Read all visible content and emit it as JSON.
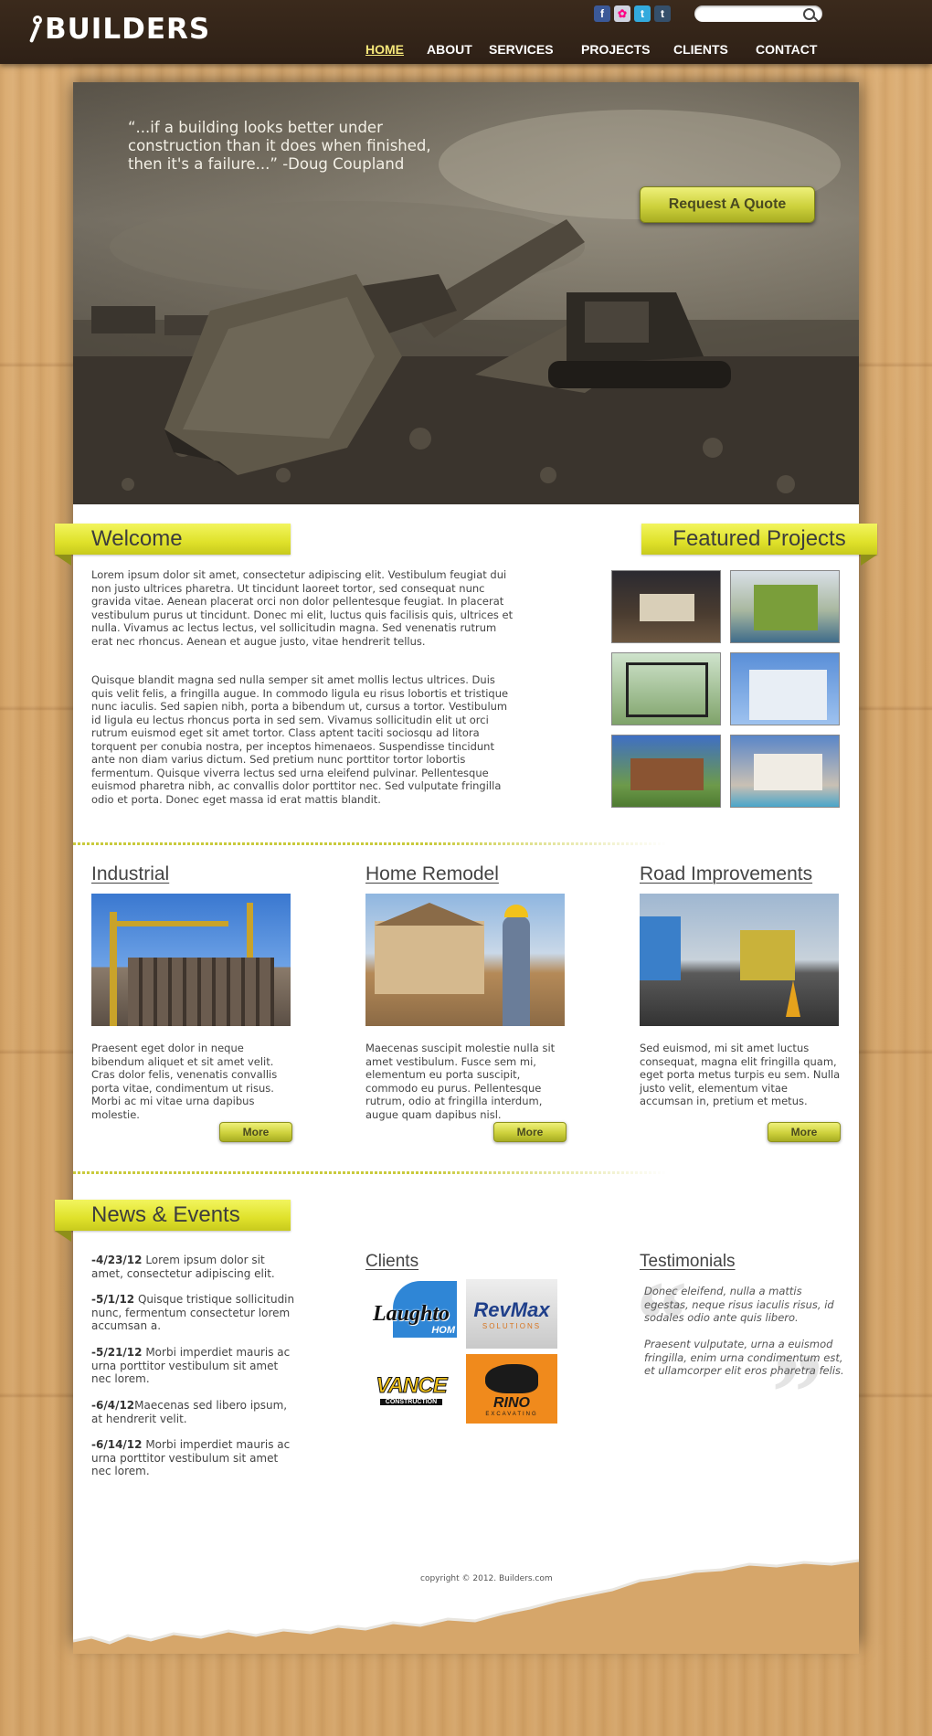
{
  "header": {
    "logo": "BUILDERS",
    "nav": [
      "HOME",
      "ABOUT",
      "SERVICES",
      "PROJECTS",
      "CLIENTS",
      "CONTACT"
    ],
    "social": [
      "f",
      "✿",
      "t",
      "t"
    ],
    "social_icons": [
      "facebook-icon",
      "flickr-icon",
      "twitter-icon",
      "tumblr-icon"
    ],
    "search": {
      "placeholder": ""
    }
  },
  "hero": {
    "quote": "“...if a building looks better under construction than it does when finished, then it's a failure...” -Doug Coupland",
    "button": "Request A Quote"
  },
  "welcome": {
    "title": "Welcome",
    "p1": "Lorem ipsum dolor sit amet, consectetur adipiscing elit. Vestibulum feugiat dui non justo ultrices pharetra. Ut tincidunt laoreet tortor, sed consequat nunc gravida vitae. Aenean placerat orci non dolor pellentesque feugiat. In placerat vestibulum purus ut tincidunt. Donec mi elit, luctus quis facilisis quis, ultrices et nulla. Vivamus ac lectus lectus, vel sollicitudin magna. Sed venenatis rutrum erat nec rhoncus. Aenean et augue justo, vitae hendrerit tellus.",
    "p2": "Quisque blandit magna sed nulla semper sit amet mollis lectus ultrices. Duis quis velit felis, a fringilla augue. In commodo ligula eu risus lobortis et tristique nunc iaculis. Sed sapien nibh, porta a bibendum ut, cursus a tortor. Vestibulum id ligula eu lectus rhoncus porta in sed sem. Vivamus sollicitudin elit ut orci rutrum euismod eget sit amet tortor. Class aptent taciti sociosqu ad litora torquent per conubia nostra, per inceptos himenaeos. Suspendisse tincidunt ante non diam varius dictum. Sed pretium nunc porttitor tortor lobortis fermentum. Quisque viverra lectus sed urna eleifend pulvinar. Pellentesque euismod pharetra nibh, ac convallis dolor porttitor nec. Sed vulputate fringilla odio et porta. Donec eget massa id erat mattis blandit."
  },
  "featured": {
    "title": "Featured Projects"
  },
  "services": [
    {
      "title": "Industrial",
      "text": "Praesent eget dolor in neque bibendum aliquet et sit amet velit. Cras dolor felis, venenatis convallis porta vitae, condimentum ut risus. Morbi ac mi vitae urna dapibus molestie.",
      "more": "More"
    },
    {
      "title": "Home Remodel",
      "text": "Maecenas suscipit molestie nulla sit amet vestibulum. Fusce sem mi, elementum eu porta suscipit, commodo eu purus. Pellentesque rutrum, odio at fringilla interdum, augue quam dapibus nisl.",
      "more": "More"
    },
    {
      "title": "Road Improvements",
      "text": "Sed euismod, mi sit amet luctus consequat, magna elit fringilla quam, eget porta metus turpis eu sem. Nulla justo velit, elementum vitae accumsan in, pretium et metus.",
      "more": "More"
    }
  ],
  "news": {
    "title": "News & Events",
    "items": [
      {
        "date": "-4/23/12",
        "text": "Lorem ipsum dolor sit amet, consectetur adipiscing elit."
      },
      {
        "date": "-5/1/12",
        "text": "Quisque tristique sollicitudin nunc, fermentum consectetur lorem accumsan a."
      },
      {
        "date": "-5/21/12",
        "text": "Morbi imperdiet mauris ac urna porttitor vestibulum sit amet nec lorem."
      },
      {
        "date": "-6/4/12",
        "text": "Maecenas sed libero ipsum, at hendrerit velit."
      },
      {
        "date": "-6/14/12",
        "text": "Morbi imperdiet mauris ac urna porttitor vestibulum sit amet nec lorem."
      }
    ]
  },
  "clients": {
    "title": "Clients",
    "logos": [
      "Laughto",
      "HOM",
      "RevMax",
      "SOLUTIONS",
      "VANCE",
      "CONSTRUCTION",
      "RINO",
      "EXCAVATING"
    ]
  },
  "testimonials": {
    "title": "Testimonials",
    "items": [
      "Donec eleifend, nulla a mattis egestas, neque risus iaculis risus, id sodales odio ante quis libero.",
      "Praesent vulputate, urna a euismod fringilla, enim urna condimentum est, et ullamcorper elit eros pharetra felis."
    ]
  },
  "footer": {
    "copyright": "copyright © 2012. Builders.com"
  }
}
